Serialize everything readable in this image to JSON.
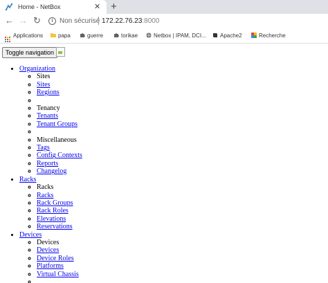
{
  "browser": {
    "tab_title": "Home - NetBox",
    "close_glyph": "✕",
    "newtab_glyph": "+",
    "back_glyph": "←",
    "forward_glyph": "→",
    "reload_glyph": "↻",
    "security_text": "Non sécurisé",
    "url_host": "172.22.76.23",
    "url_port": ":8000"
  },
  "bookmarks": [
    {
      "label": "Applications",
      "icon": "apps-grid-icon"
    },
    {
      "label": "papa",
      "icon": "folder-icon",
      "color": "#f6c344"
    },
    {
      "label": "guerre",
      "icon": "puzzle-icon"
    },
    {
      "label": "torikae",
      "icon": "puzzle-icon"
    },
    {
      "label": "Netbox | IPAM, DCI...",
      "icon": "globe-icon"
    },
    {
      "label": "Apache2",
      "icon": "book-icon"
    },
    {
      "label": "Recherche",
      "icon": "google-apps-icon"
    }
  ],
  "page": {
    "toggle_label": "Toggle navigation",
    "menu": [
      {
        "label": "Organization",
        "items": [
          {
            "label": "Sites",
            "link": false
          },
          {
            "label": "Sites",
            "link": true
          },
          {
            "label": "Regions",
            "link": true
          },
          {
            "label": "",
            "link": false
          },
          {
            "label": "Tenancy",
            "link": false
          },
          {
            "label": "Tenants",
            "link": true
          },
          {
            "label": "Tenant Groups",
            "link": true
          },
          {
            "label": "",
            "link": false
          },
          {
            "label": "Miscellaneous",
            "link": false
          },
          {
            "label": "Tags",
            "link": true
          },
          {
            "label": "Config Contexts",
            "link": true
          },
          {
            "label": "Reports",
            "link": true
          },
          {
            "label": "Changelog",
            "link": true
          }
        ]
      },
      {
        "label": "Racks",
        "items": [
          {
            "label": "Racks",
            "link": false
          },
          {
            "label": "Racks",
            "link": true
          },
          {
            "label": "Rack Groups",
            "link": true
          },
          {
            "label": "Rack Roles",
            "link": true
          },
          {
            "label": "Elevations",
            "link": true
          },
          {
            "label": "Reservations",
            "link": true
          }
        ]
      },
      {
        "label": "Devices",
        "items": [
          {
            "label": "Devices",
            "link": false
          },
          {
            "label": "Devices",
            "link": true
          },
          {
            "label": "Device Roles",
            "link": true
          },
          {
            "label": "Platforms",
            "link": true
          },
          {
            "label": "Virtual Chassis",
            "link": true
          },
          {
            "label": "",
            "link": false
          }
        ]
      }
    ]
  }
}
